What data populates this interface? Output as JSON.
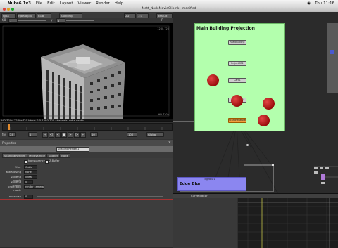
{
  "menubar": {
    "apple": "",
    "items": [
      "Nuke6.1v3",
      "File",
      "Edit",
      "Layout",
      "Viewer",
      "Render",
      "Help"
    ],
    "clock": "Thu 11:16"
  },
  "window": {
    "title": "Matt_NodeMovieClip.nk - modified"
  },
  "viewer": {
    "channels": "rgba",
    "channel2": "rgba.alpha",
    "channel3": "RGB",
    "input": "Backdrop",
    "view_mode": "2D",
    "zoom": "1:1",
    "proxy": "default",
    "gain_label": "f/8",
    "gain_value": "1",
    "gamma_label": "y",
    "gamma_value": "1",
    "ip_label": "IP",
    "corner_top": "1280,720",
    "corner_bottom": "HD 720p",
    "info_line": "HD 720p 1280x720  bbox: 0 0 1280 720 channels: rgba,depth"
  },
  "timeline": {
    "fps_label": "fps",
    "fps": "24",
    "frame": "1",
    "play_controls": [
      "|<",
      "<|",
      "<",
      "■",
      ">",
      "|>",
      ">|"
    ],
    "step": "10",
    "range_end": "100",
    "global": "Global"
  },
  "properties": {
    "header": "Properties",
    "node_name": "ScanlineRender1",
    "tabs": [
      "ScanlineRender",
      "Multisample",
      "Shader",
      "Node"
    ],
    "checkbox_label": "transparency",
    "checkbox2_label": "Z-Buffer",
    "rows": [
      {
        "label": "filter",
        "value": "Cubic"
      },
      {
        "label": "antialiasing",
        "value": "none"
      },
      {
        "label": "Z-blend mode",
        "value": "linear"
      },
      {
        "label": "Z-blend range",
        "value": "0"
      },
      {
        "label": "projection mode",
        "value": "render camera"
      },
      {
        "label": "overscan",
        "value": "0"
      }
    ]
  },
  "nodegraph": {
    "backdrop_label": "Main Building Projection",
    "nodes": [
      {
        "label": "ReadBuilding"
      },
      {
        "label": "Project3D1"
      },
      {
        "label": "Card1"
      },
      {
        "label": "Project3D2"
      },
      {
        "label": "ScanlineRender1"
      }
    ],
    "edge_blur_label": "Edge Blur",
    "edge_blur_node": "EdgeBlur1"
  },
  "curve_editor": {
    "title": "Curve Editor"
  },
  "colors": {
    "backdrop_green": "#b3ffad",
    "edge_blur_purple": "#8b86f0",
    "camera_ball": "#c81d1d",
    "selected_node": "#f0a040"
  }
}
